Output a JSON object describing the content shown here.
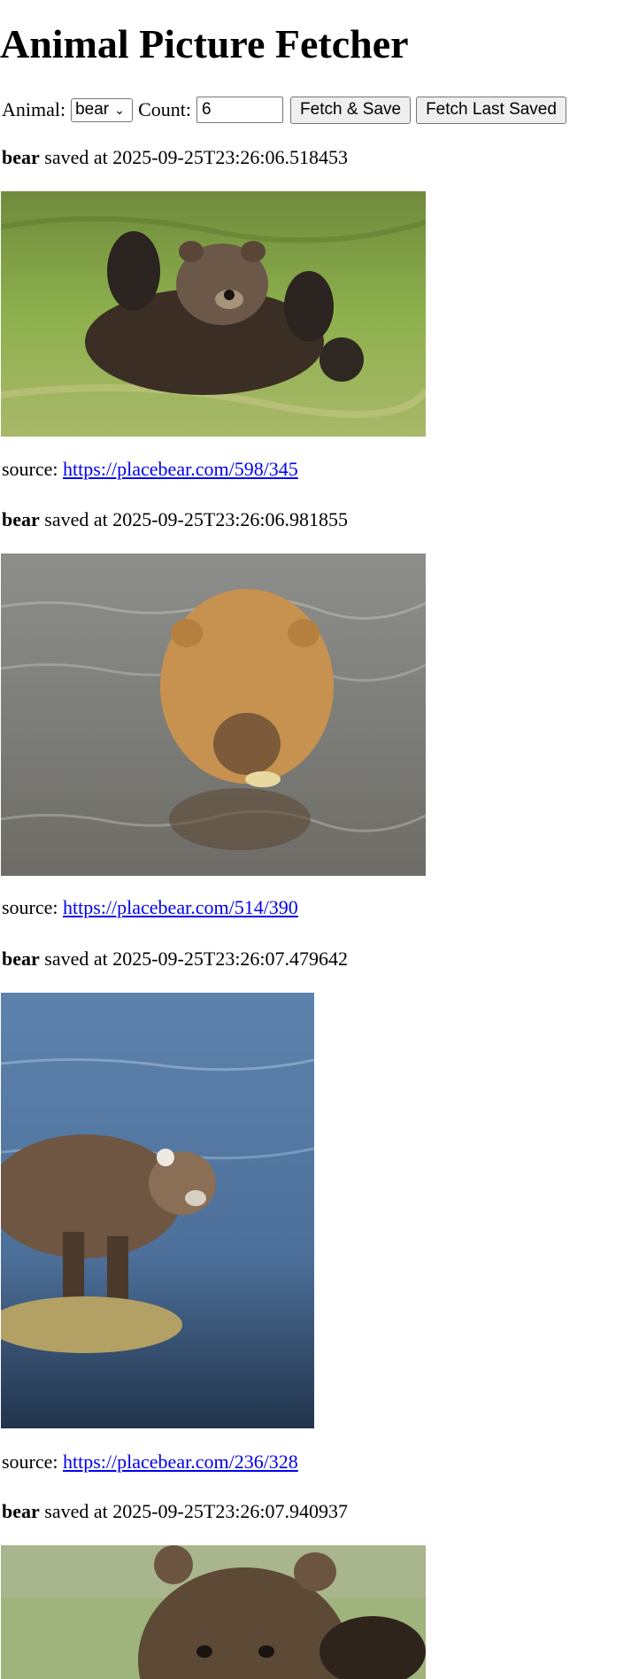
{
  "title": "Animal Picture Fetcher",
  "controls": {
    "animal_label": "Animal:",
    "animal_selected": "bear",
    "count_label": "Count:",
    "count_value": "6",
    "fetch_save_label": "Fetch & Save",
    "fetch_last_label": "Fetch Last Saved"
  },
  "results": [
    {
      "animal": "bear",
      "saved_text": "saved at 2025-09-25T23:26:06.518453",
      "source_label": "source:",
      "url": "https://placebear.com/598/345"
    },
    {
      "animal": "bear",
      "saved_text": "saved at 2025-09-25T23:26:06.981855",
      "source_label": "source:",
      "url": "https://placebear.com/514/390"
    },
    {
      "animal": "bear",
      "saved_text": "saved at 2025-09-25T23:26:07.479642",
      "source_label": "source:",
      "url": "https://placebear.com/236/328"
    },
    {
      "animal": "bear",
      "saved_text": "saved at 2025-09-25T23:26:07.940937"
    }
  ]
}
